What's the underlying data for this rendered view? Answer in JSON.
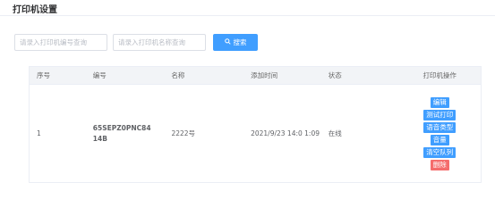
{
  "page": {
    "title": "打印机设置"
  },
  "search": {
    "code_placeholder": "请录入打印机编号查询",
    "name_placeholder": "请录入打印机名称查询",
    "button_label": "搜索",
    "button_icon": "search-icon"
  },
  "table": {
    "columns": [
      "序号",
      "编号",
      "名称",
      "添加时间",
      "状态",
      "打印机操作"
    ],
    "rows": [
      {
        "index": "1",
        "code": "65SEPZ0PNC84 14B",
        "name": "2222号",
        "added_time": "2021/9/23 14:0 1:09",
        "status": "在线",
        "actions": [
          "编辑",
          "测试打印",
          "语音类型",
          "音量",
          "清空队列",
          "删除"
        ]
      }
    ]
  },
  "colors": {
    "primary": "#409eff",
    "danger": "#f56c6c",
    "header_bg": "#f2f4f7"
  }
}
